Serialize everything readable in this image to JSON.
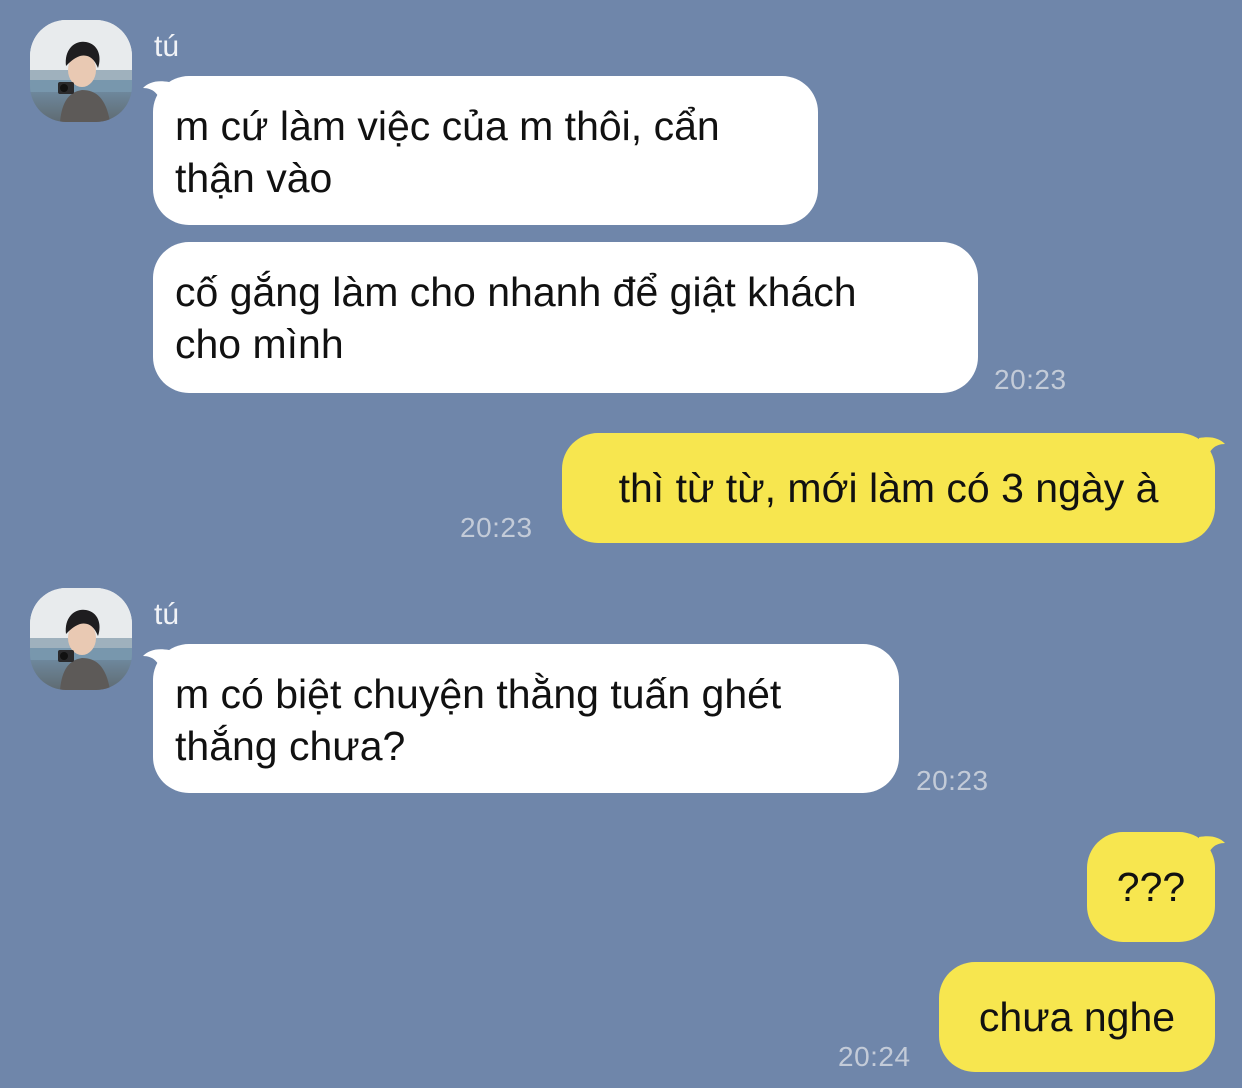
{
  "contact": {
    "name": "tú",
    "avatar_icon": "profile-photo-icon"
  },
  "colors": {
    "background": "#6f86aa",
    "incoming_bubble": "#ffffff",
    "outgoing_bubble": "#f7e64f",
    "timestamp": "#c3cbd8"
  },
  "messages": [
    {
      "direction": "incoming",
      "lines": [
        "m cứ làm việc của m thôi, cẩn",
        "thận vào"
      ]
    },
    {
      "direction": "incoming",
      "lines": [
        "cố gắng làm cho nhanh để giật khách",
        "cho mình"
      ],
      "time": "20:23"
    },
    {
      "direction": "outgoing",
      "text": "thì từ từ, mới làm có 3 ngày à",
      "time": "20:23"
    },
    {
      "direction": "incoming",
      "lines": [
        "m có biệt chuyện thằng tuấn ghét",
        "thắng chưa?"
      ],
      "time": "20:23"
    },
    {
      "direction": "outgoing",
      "text": "???"
    },
    {
      "direction": "outgoing",
      "text": "chưa nghe",
      "time": "20:24"
    }
  ]
}
